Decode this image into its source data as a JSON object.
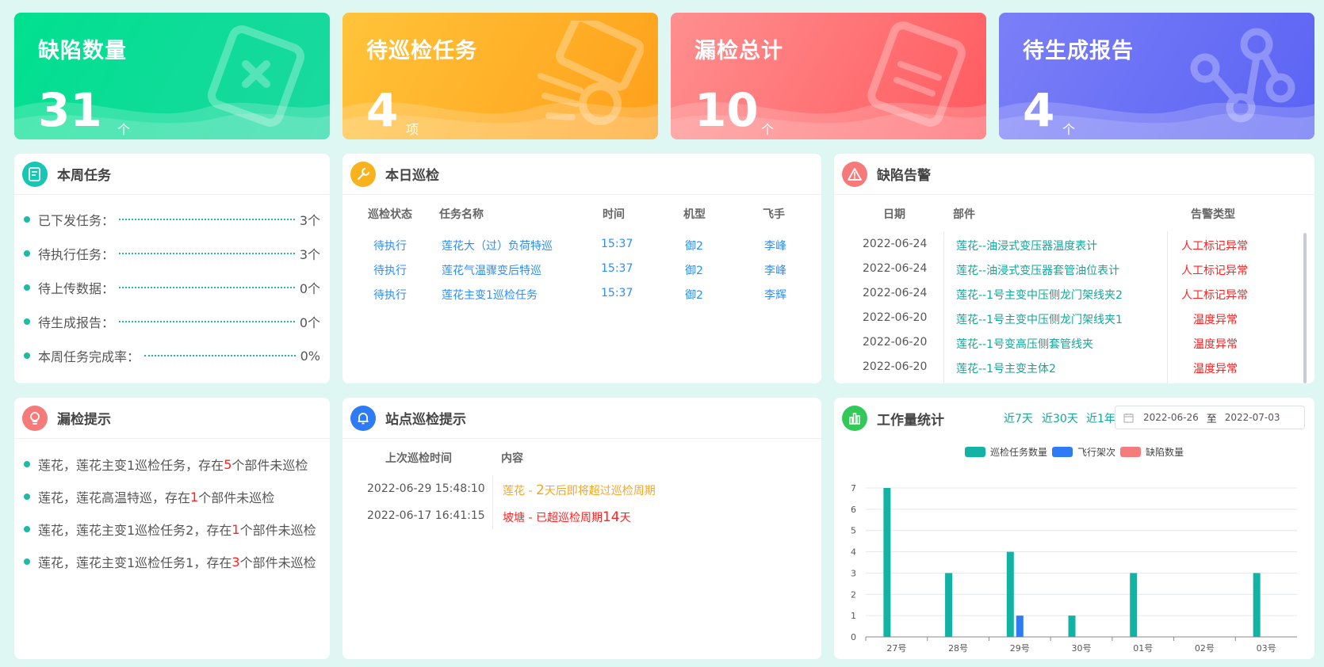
{
  "stats": [
    {
      "title": "缺陷数量",
      "value": "31",
      "unit": "个"
    },
    {
      "title": "待巡检任务",
      "value": "4",
      "unit": "项"
    },
    {
      "title": "漏检总计",
      "value": "10",
      "unit": "个"
    },
    {
      "title": "待生成报告",
      "value": "4",
      "unit": "个"
    }
  ],
  "weekly": {
    "title": "本周任务",
    "items": [
      {
        "label": "已下发任务：",
        "value": "3个"
      },
      {
        "label": "待执行任务：",
        "value": "3个"
      },
      {
        "label": "待上传数据：",
        "value": "0个"
      },
      {
        "label": "待生成报告：",
        "value": "0个"
      },
      {
        "label": "本周任务完成率：",
        "value": "0%"
      }
    ]
  },
  "today": {
    "title": "本日巡检",
    "headers": [
      "巡检状态",
      "任务名称",
      "时间",
      "机型",
      "飞手"
    ],
    "rows": [
      [
        "待执行",
        "莲花大（过）负荷特巡",
        "15:37",
        "御2",
        "李峰"
      ],
      [
        "待执行",
        "莲花气温骤变后特巡",
        "15:37",
        "御2",
        "李峰"
      ],
      [
        "待执行",
        "莲花主变1巡检任务",
        "15:37",
        "御2",
        "李辉"
      ]
    ]
  },
  "defect": {
    "title": "缺陷告警",
    "headers": [
      "日期",
      "部件",
      "告警类型"
    ],
    "rows": [
      [
        "2022-06-24",
        "莲花--油浸式变压器温度表计",
        "人工标记异常"
      ],
      [
        "2022-06-24",
        "莲花--油浸式变压器套管油位表计",
        "人工标记异常"
      ],
      [
        "2022-06-24",
        "莲花--1号主变中压侧龙门架线夹2",
        "人工标记异常"
      ],
      [
        "2022-06-20",
        "莲花--1号主变中压侧龙门架线夹1",
        "温度异常"
      ],
      [
        "2022-06-20",
        "莲花--1号变高压侧套管线夹",
        "温度异常"
      ],
      [
        "2022-06-20",
        "莲花--1号主变主体2",
        "温度异常"
      ]
    ]
  },
  "missed": {
    "title": "漏检提示",
    "items": [
      {
        "pre": "莲花，莲花主变1巡检任务，存在",
        "n": "5",
        "post": "个部件未巡检"
      },
      {
        "pre": "莲花，莲花高温特巡，存在",
        "n": "1",
        "post": "个部件未巡检"
      },
      {
        "pre": "莲花，莲花主变1巡检任务2，存在",
        "n": "1",
        "post": "个部件未巡检"
      },
      {
        "pre": "莲花，莲花主变1巡检任务1，存在",
        "n": "3",
        "post": "个部件未巡检"
      }
    ]
  },
  "station": {
    "title": "站点巡检提示",
    "headers": [
      "上次巡检时间",
      "内容"
    ],
    "rows": [
      {
        "time": "2022-06-29 15:48:10",
        "pre": "莲花 - ",
        "num": "2",
        "post": "天后即将超过巡检周期"
      },
      {
        "time": "2022-06-17 16:41:15",
        "pre": "坡塘 - 已超巡检周期",
        "num": "14",
        "post": "天"
      }
    ]
  },
  "workload": {
    "title": "工作量统计",
    "ranges": [
      "近7天",
      "近30天",
      "近1年"
    ],
    "date_from": "2022-06-26",
    "date_sep": "至",
    "date_to": "2022-07-03"
  },
  "chart_data": {
    "type": "bar",
    "categories": [
      "27号",
      "28号",
      "29号",
      "30号",
      "01号",
      "02号",
      "03号"
    ],
    "series": [
      {
        "name": "巡检任务数量",
        "color": "#12b3a4",
        "values": [
          7,
          3,
          4,
          1,
          3,
          0,
          3
        ]
      },
      {
        "name": "飞行架次",
        "color": "#2f7bf6",
        "values": [
          0,
          0,
          1,
          0,
          0,
          0,
          0
        ]
      },
      {
        "name": "缺陷数量",
        "color": "#f47c7c",
        "values": [
          0,
          0,
          0,
          0,
          0,
          0,
          0
        ]
      }
    ],
    "ylim": [
      0,
      7
    ],
    "yticks": [
      "0",
      "1",
      "2",
      "3",
      "4",
      "5",
      "6",
      "7"
    ],
    "grid": true,
    "legend": "top"
  }
}
